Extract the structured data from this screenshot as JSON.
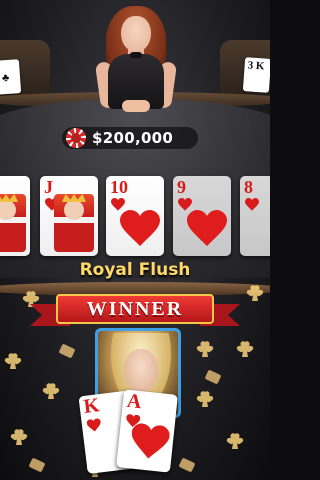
{
  "table": {
    "pot_amount": "$200,000",
    "hand_name": "Royal Flush",
    "winner_label": "WINNER"
  },
  "board_cards": [
    {
      "rank": "K",
      "suit": "hearts"
    },
    {
      "rank": "J",
      "suit": "hearts"
    },
    {
      "rank": "10",
      "suit": "hearts"
    },
    {
      "rank": "9",
      "suit": "hearts",
      "dimmed": true
    },
    {
      "rank": "8",
      "suit": "hearts",
      "dimmed": true
    }
  ],
  "winner_hand": [
    {
      "rank": "K",
      "suit": "hearts"
    },
    {
      "rank": "A",
      "suit": "hearts"
    }
  ],
  "side_cards": {
    "left": "♣",
    "right": "3 K"
  },
  "colors": {
    "pot_chip": "#d42b2b",
    "hand_name": "#ffd86a",
    "winner_ribbon": "#d8262a",
    "avatar_border": "#3fa0e6"
  },
  "icons": {
    "chip": "poker-chip-icon",
    "heart": "heart-icon"
  }
}
